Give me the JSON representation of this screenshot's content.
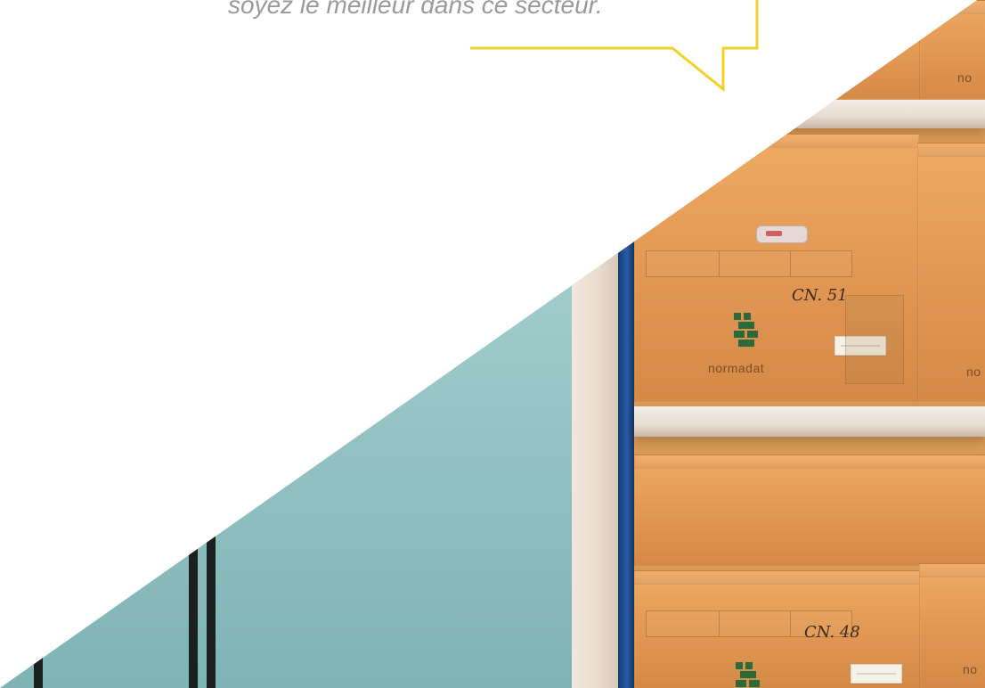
{
  "quote": {
    "text": "soyez le meilleur dans ce secteur."
  },
  "photo": {
    "boxes": {
      "brand": "normadat",
      "handwritten_labels": [
        "CN. 51",
        "CN. 48"
      ],
      "partial_brand": "no"
    }
  },
  "colors": {
    "bubble_outline": "#f2d12b",
    "quote_text": "#9a9a9a"
  }
}
